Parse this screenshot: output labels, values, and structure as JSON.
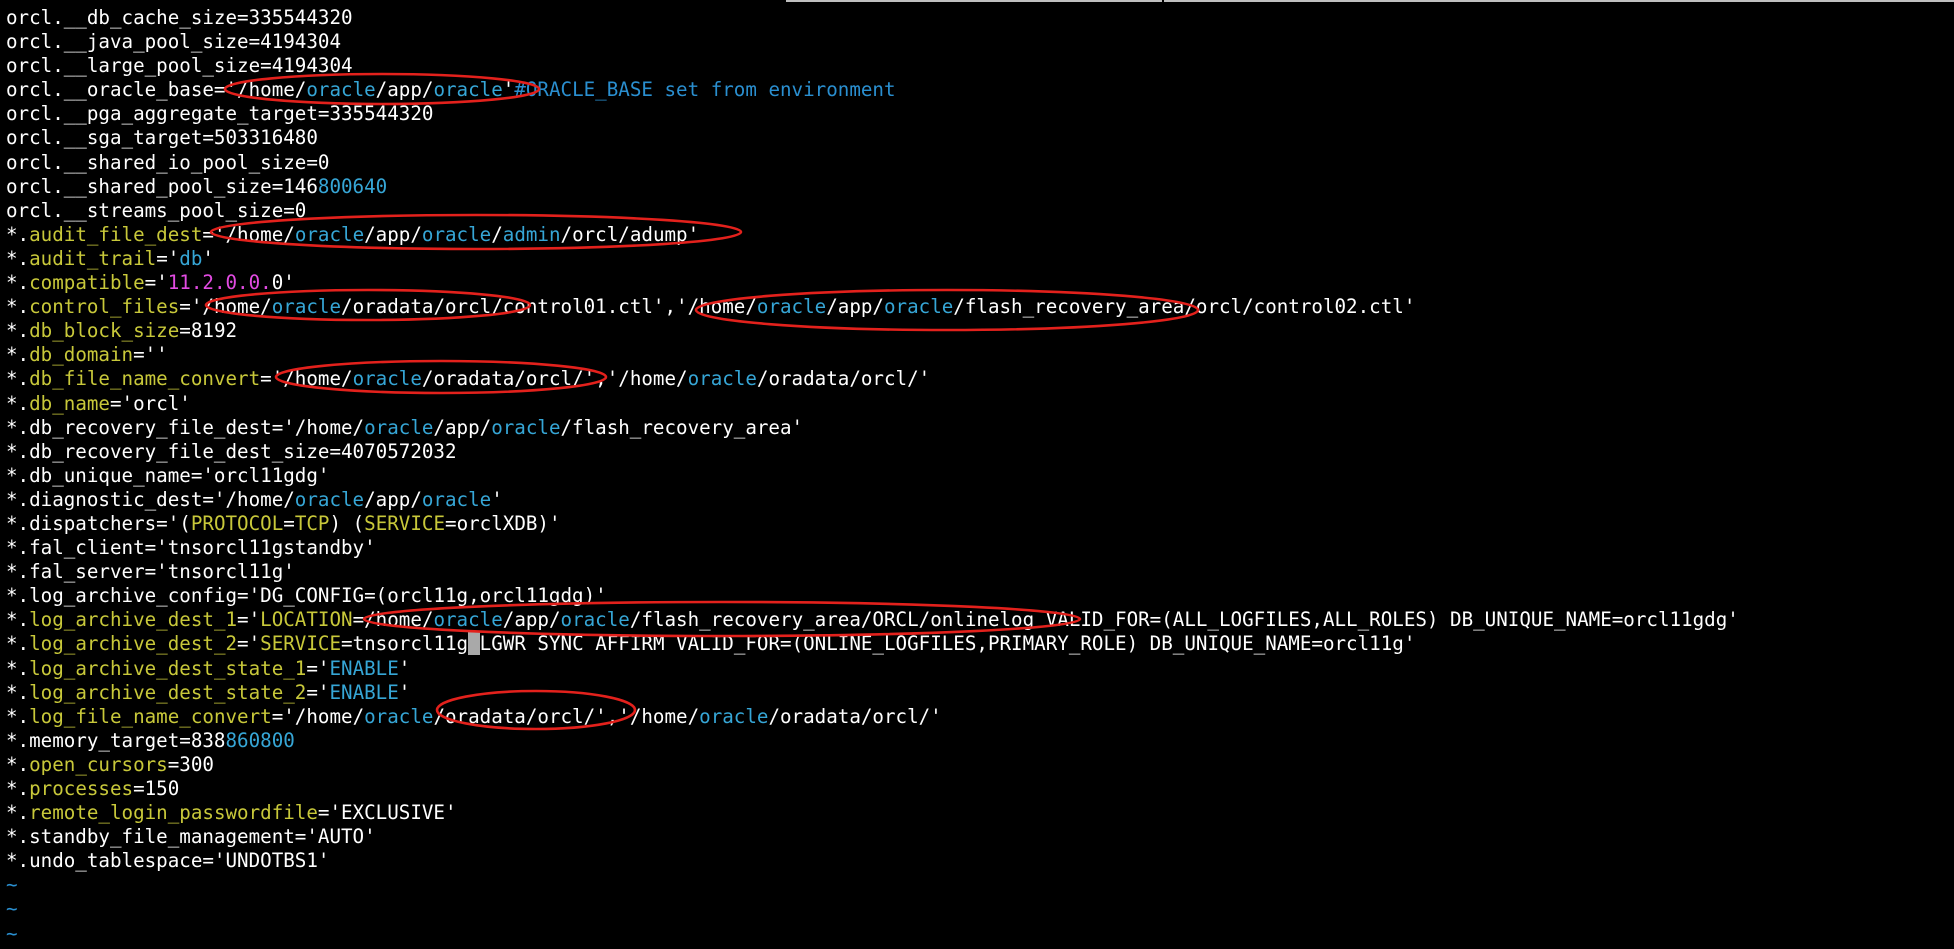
{
  "editor": {
    "lines": [
      [
        {
          "t": "orcl.__db_cache_size=335544320",
          "c": "w"
        }
      ],
      [
        {
          "t": "orcl.__java_pool_size=4194304",
          "c": "w"
        }
      ],
      [
        {
          "t": "orcl.__large_pool_size=4194304",
          "c": "w"
        }
      ],
      [
        {
          "t": "orcl.__oracle_base='/home/",
          "c": "w"
        },
        {
          "t": "oracle",
          "c": "b"
        },
        {
          "t": "/app/",
          "c": "w"
        },
        {
          "t": "oracle",
          "c": "b"
        },
        {
          "t": "'",
          "c": "w"
        },
        {
          "t": "#ORACLE_BASE set from environment",
          "c": "t"
        }
      ],
      [
        {
          "t": "orcl.__pga_aggregate_target=335544320",
          "c": "w"
        }
      ],
      [
        {
          "t": "orcl.__sga_target=503316480",
          "c": "w"
        }
      ],
      [
        {
          "t": "orcl.__shared_io_pool_size=0",
          "c": "w"
        }
      ],
      [
        {
          "t": "orcl.__shared_pool_size=146",
          "c": "w"
        },
        {
          "t": "800640",
          "c": "b"
        }
      ],
      [
        {
          "t": "orcl.__streams_pool_size=0",
          "c": "w"
        }
      ],
      [
        {
          "t": "*.",
          "c": "w"
        },
        {
          "t": "audit_file_dest",
          "c": "y"
        },
        {
          "t": "='/home/",
          "c": "w"
        },
        {
          "t": "oracle",
          "c": "b"
        },
        {
          "t": "/app/",
          "c": "w"
        },
        {
          "t": "oracle",
          "c": "b"
        },
        {
          "t": "/",
          "c": "w"
        },
        {
          "t": "admin",
          "c": "b"
        },
        {
          "t": "/orcl/adump'",
          "c": "w"
        }
      ],
      [
        {
          "t": "*.",
          "c": "w"
        },
        {
          "t": "audit_trail",
          "c": "y"
        },
        {
          "t": "='",
          "c": "w"
        },
        {
          "t": "db",
          "c": "b"
        },
        {
          "t": "'",
          "c": "w"
        }
      ],
      [
        {
          "t": "*.",
          "c": "w"
        },
        {
          "t": "compatible",
          "c": "y"
        },
        {
          "t": "='",
          "c": "w"
        },
        {
          "t": "11.2.0.0.",
          "c": "m"
        },
        {
          "t": "0'",
          "c": "w"
        }
      ],
      [
        {
          "t": "*.",
          "c": "w"
        },
        {
          "t": "control_files",
          "c": "y"
        },
        {
          "t": "='/home/",
          "c": "w"
        },
        {
          "t": "oracle",
          "c": "b"
        },
        {
          "t": "/oradata/orcl/control01.ctl','/home/",
          "c": "w"
        },
        {
          "t": "oracle",
          "c": "b"
        },
        {
          "t": "/app/",
          "c": "w"
        },
        {
          "t": "oracle",
          "c": "b"
        },
        {
          "t": "/flash_recovery_area/orcl/control02.ctl'",
          "c": "w"
        }
      ],
      [
        {
          "t": "*.",
          "c": "w"
        },
        {
          "t": "db_block_size",
          "c": "y"
        },
        {
          "t": "=8192",
          "c": "w"
        }
      ],
      [
        {
          "t": "*.",
          "c": "w"
        },
        {
          "t": "db_domain",
          "c": "y"
        },
        {
          "t": "=''",
          "c": "w"
        }
      ],
      [
        {
          "t": "*.",
          "c": "w"
        },
        {
          "t": "db_file_name_convert",
          "c": "y"
        },
        {
          "t": "='/home/",
          "c": "w"
        },
        {
          "t": "oracle",
          "c": "b"
        },
        {
          "t": "/oradata/orcl/','/home/",
          "c": "w"
        },
        {
          "t": "oracle",
          "c": "b"
        },
        {
          "t": "/oradata/orcl/'",
          "c": "w"
        }
      ],
      [
        {
          "t": "*.",
          "c": "w"
        },
        {
          "t": "db_name",
          "c": "y"
        },
        {
          "t": "='orcl'",
          "c": "w"
        }
      ],
      [
        {
          "t": "*.db_recovery_file_dest='/home/",
          "c": "w"
        },
        {
          "t": "oracle",
          "c": "b"
        },
        {
          "t": "/app/",
          "c": "w"
        },
        {
          "t": "oracle",
          "c": "b"
        },
        {
          "t": "/flash_recovery_area'",
          "c": "w"
        }
      ],
      [
        {
          "t": "*.db_recovery_file_dest_size=4070572032",
          "c": "w"
        }
      ],
      [
        {
          "t": "*.db_unique_name='orcl11gdg'",
          "c": "w"
        }
      ],
      [
        {
          "t": "*.diagnostic_dest='/home/",
          "c": "w"
        },
        {
          "t": "oracle",
          "c": "b"
        },
        {
          "t": "/app/",
          "c": "w"
        },
        {
          "t": "oracle",
          "c": "b"
        },
        {
          "t": "'",
          "c": "w"
        }
      ],
      [
        {
          "t": "*.dispatchers='(",
          "c": "w"
        },
        {
          "t": "PROTOCOL",
          "c": "y"
        },
        {
          "t": "=",
          "c": "w"
        },
        {
          "t": "TCP",
          "c": "y"
        },
        {
          "t": ") (",
          "c": "w"
        },
        {
          "t": "SERVICE",
          "c": "y"
        },
        {
          "t": "=orclXDB)'",
          "c": "w"
        }
      ],
      [
        {
          "t": "*.fal_client='tnsorcl11gstandby'",
          "c": "w"
        }
      ],
      [
        {
          "t": "*.fal_server='tnsorcl11g'",
          "c": "w"
        }
      ],
      [
        {
          "t": "*.log_archive_config='DG_CONFIG=(orcl11g,orcl11gdg)'",
          "c": "w"
        }
      ],
      [
        {
          "t": "*.",
          "c": "w"
        },
        {
          "t": "log_archive_dest_1",
          "c": "y"
        },
        {
          "t": "='",
          "c": "w"
        },
        {
          "t": "LOCATION",
          "c": "y"
        },
        {
          "t": "=/home/",
          "c": "w"
        },
        {
          "t": "oracle",
          "c": "b"
        },
        {
          "t": "/app/",
          "c": "w"
        },
        {
          "t": "oracle",
          "c": "b"
        },
        {
          "t": "/flash_recovery_area/ORCL/onlinelog VALID_FOR=(ALL_LOGFILES,ALL_ROLES) DB_UNIQUE_NAME=orcl11gdg'",
          "c": "w"
        }
      ],
      [
        {
          "t": "*.",
          "c": "w"
        },
        {
          "t": "log_archive_dest_2",
          "c": "y"
        },
        {
          "t": "='",
          "c": "w"
        },
        {
          "t": "SERVICE",
          "c": "y"
        },
        {
          "t": "=tnsorcl11g",
          "c": "w"
        },
        {
          "t": " ",
          "c": "cursor"
        },
        {
          "t": "LGWR SYNC AFFIRM VALID_FOR=(ONLINE_LOGFILES,PRIMARY_ROLE) DB_UNIQUE_NAME=orcl11g'",
          "c": "w"
        }
      ],
      [
        {
          "t": "*.",
          "c": "w"
        },
        {
          "t": "log_archive_dest_state_1",
          "c": "y"
        },
        {
          "t": "='",
          "c": "w"
        },
        {
          "t": "ENABLE",
          "c": "b"
        },
        {
          "t": "'",
          "c": "w"
        }
      ],
      [
        {
          "t": "*.",
          "c": "w"
        },
        {
          "t": "log_archive_dest_state_2",
          "c": "y"
        },
        {
          "t": "='",
          "c": "w"
        },
        {
          "t": "ENABLE",
          "c": "b"
        },
        {
          "t": "'",
          "c": "w"
        }
      ],
      [
        {
          "t": "*.",
          "c": "w"
        },
        {
          "t": "log_file_name_convert",
          "c": "y"
        },
        {
          "t": "='/home/",
          "c": "w"
        },
        {
          "t": "oracle",
          "c": "b"
        },
        {
          "t": "/oradata/orcl/','/home/",
          "c": "w"
        },
        {
          "t": "oracle",
          "c": "b"
        },
        {
          "t": "/oradata/orcl/'",
          "c": "w"
        }
      ],
      [
        {
          "t": "*.memory_target=838",
          "c": "w"
        },
        {
          "t": "860800",
          "c": "b"
        }
      ],
      [
        {
          "t": "*.",
          "c": "w"
        },
        {
          "t": "open_cursors",
          "c": "y"
        },
        {
          "t": "=300",
          "c": "w"
        }
      ],
      [
        {
          "t": "*.",
          "c": "w"
        },
        {
          "t": "processes",
          "c": "y"
        },
        {
          "t": "=150",
          "c": "w"
        }
      ],
      [
        {
          "t": "*.",
          "c": "w"
        },
        {
          "t": "remote_login_passwordfile",
          "c": "y"
        },
        {
          "t": "='EXCLUSIVE'",
          "c": "w"
        }
      ],
      [
        {
          "t": "*.standby_file_management='AUTO'",
          "c": "w"
        }
      ],
      [
        {
          "t": "*.undo_tablespace='UNDOTBS1'",
          "c": "w"
        }
      ],
      [
        {
          "t": "~",
          "c": "tilde"
        }
      ],
      [
        {
          "t": "~",
          "c": "tilde"
        }
      ],
      [
        {
          "t": "~",
          "c": "tilde"
        }
      ]
    ]
  },
  "colors": {
    "background": "#000000",
    "text": "#ffffff",
    "keyword": "#c8c83a",
    "identifier": "#36a6d6",
    "number": "#e24be2",
    "comment": "#2a8fd0",
    "annotation": "#e3211c"
  }
}
